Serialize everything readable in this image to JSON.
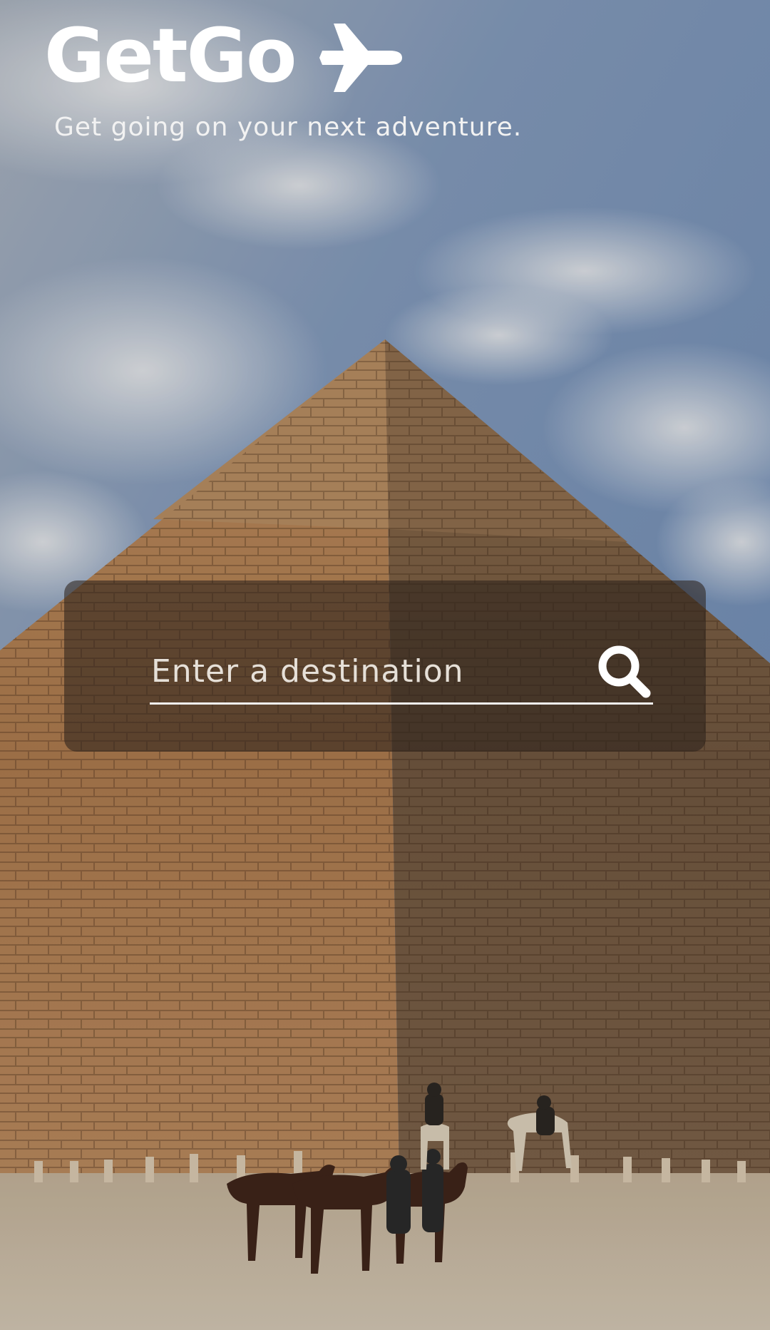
{
  "app": {
    "brand": "GetGo",
    "tagline": "Get going on your next adventure.",
    "brand_icon": "airplane-icon"
  },
  "search": {
    "placeholder": "Enter a destination",
    "value": "",
    "button_icon": "search-icon"
  },
  "background": {
    "image": "pyramid-photo",
    "colors": {
      "sky": "#7d93b5",
      "stone_light": "#c79a68",
      "stone_dark": "#6e5038",
      "sand": "#c8bca8"
    }
  }
}
